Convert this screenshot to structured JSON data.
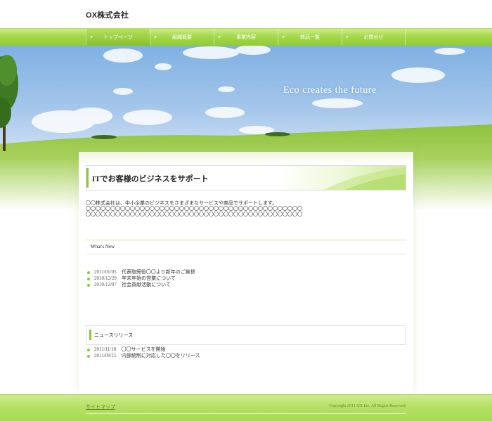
{
  "header": {
    "logo": "OX株式会社"
  },
  "nav": {
    "items": [
      {
        "label": "トップページ"
      },
      {
        "label": "組織概要"
      },
      {
        "label": "事業内容"
      },
      {
        "label": "商品一覧"
      },
      {
        "label": "お問合せ"
      }
    ],
    "active_index": 0
  },
  "hero": {
    "tagline": "Eco creates the future"
  },
  "main": {
    "heading": "ITでお客様のビジネスをサポート",
    "intro": [
      "〇〇株式会社は、中小企業のビジネスをさまざまなサービスや商品でサポートします。",
      "〇〇〇〇〇〇〇〇〇〇〇〇〇〇〇〇〇〇〇〇〇〇〇〇〇〇〇〇〇〇〇〇〇〇〇〇〇〇〇〇〇〇〇〇",
      "〇〇〇〇〇〇〇〇〇〇〇〇〇〇〇〇〇〇〇〇〇〇〇〇〇〇〇〇〇〇〇〇〇〇〇〇〇〇〇〇〇〇〇〇"
    ]
  },
  "news": {
    "heading": "What's New",
    "items": [
      {
        "date": "2011/01/05",
        "title": "代表取締役〇〇より新年のご挨拶"
      },
      {
        "date": "2010/12/29",
        "title": "年末年始の営業について"
      },
      {
        "date": "2010/12/07",
        "title": "社会貢献活動について"
      }
    ]
  },
  "release": {
    "heading": "ニュースリリース",
    "items": [
      {
        "date": "2011/11/10",
        "title": "〇〇サービスを開始"
      },
      {
        "date": "2011/09/15",
        "title": "内部統制に対応した〇〇をリリース"
      }
    ]
  },
  "footer": {
    "sitemap": "サイトマップ",
    "copyright": "Copyright 2011 OX Inc. All Rights Reserved."
  },
  "colors": {
    "accent": "#8cc63f",
    "nav": "#9fd445",
    "sky": "#8db8e8",
    "grass": "#9ccf4a"
  }
}
